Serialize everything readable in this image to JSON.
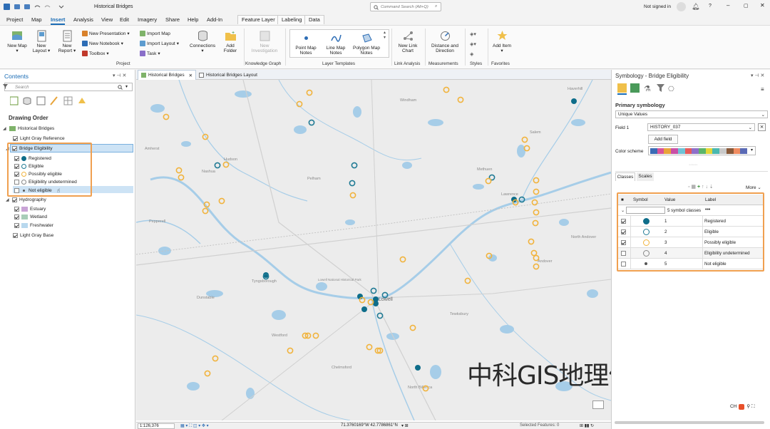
{
  "titlebar": {
    "title": "Historical Bridges",
    "search_placeholder": "Command Search (Alt+Q)",
    "signin": "Not signed in",
    "help": "?"
  },
  "menu": {
    "items": [
      "Project",
      "Map",
      "Insert",
      "Analysis",
      "View",
      "Edit",
      "Imagery",
      "Share",
      "Help",
      "Add-In"
    ],
    "active": "Insert",
    "context": [
      "Feature Layer",
      "Labeling",
      "Data"
    ]
  },
  "ribbon": {
    "new_map": "New Map",
    "new_layout": "New Layout",
    "new_report": "New Report",
    "new_presentation": "New Presentation",
    "new_notebook": "New Notebook",
    "toolbox": "Toolbox",
    "import_map": "Import Map",
    "import_layout": "Import Layout",
    "task": "Task",
    "connections": "Connections",
    "add_folder": "Add Folder",
    "new_investigation": "New Investigation",
    "point_map_notes": "Point Map Notes",
    "line_map_notes": "Line Map Notes",
    "polygon_map_notes": "Polygon Map Notes",
    "new_link_chart": "New Link Chart",
    "distance_direction": "Distance and Direction",
    "add_item": "Add Item",
    "groups": {
      "project": "Project",
      "knowledge_graph": "Knowledge Graph",
      "layer_templates": "Layer Templates",
      "link_analysis": "Link Analysis",
      "measurements": "Measurements",
      "styles": "Styles",
      "favorites": "Favorites"
    }
  },
  "contents": {
    "title": "Contents",
    "search_placeholder": "Search",
    "drawing_order": "Drawing Order",
    "map_name": "Historical Bridges",
    "layers": {
      "light_gray_reference": "Light Gray Reference",
      "bridge_eligibility": "Bridge Eligibility",
      "bridge_classes": [
        {
          "label": "Registered",
          "checked": true
        },
        {
          "label": "Eligible",
          "checked": true
        },
        {
          "label": "Possibly eligible",
          "checked": true
        },
        {
          "label": "Eligibility undetermined",
          "checked": false
        },
        {
          "label": "Not eligible",
          "checked": false
        }
      ],
      "hydrography": "Hydrography",
      "hydro_classes": [
        {
          "label": "Estuary",
          "color": "#c9a3d6"
        },
        {
          "label": "Wetland",
          "color": "#a8cdb8"
        },
        {
          "label": "Freshwater",
          "color": "#b8d8ee"
        }
      ],
      "light_gray_base": "Light Gray Base"
    }
  },
  "map": {
    "tabs": [
      "Historical Bridges",
      "Historical Bridges Layout"
    ],
    "labels": {
      "haverhill": "Haverhill",
      "nashua": "Nashua",
      "hudson": "Hudson",
      "methuen": "Methuen",
      "lawrence": "Lawrence",
      "andover": "Andover",
      "tyngsborough": "Tyngsborough",
      "dunstable": "Dunstable",
      "lowell": "Lowell",
      "chelmsford": "Chelmsford",
      "north_billerica": "North Billerica",
      "amherst": "Amherst",
      "pelham": "Pelham",
      "windham": "Windham",
      "salem": "Salem",
      "north_andover": "North Andover",
      "pepperell": "Pepperell",
      "westford": "Westford",
      "tewksbury": "Tewksbury",
      "lowell_national_historical_park": "Lowell National Historical Park"
    },
    "watermark": "中科GIS地理信息培训"
  },
  "status": {
    "scale": "1:126,376",
    "coords": "71.3760169°W 42.7786861°N",
    "selected": "Selected Features: 0"
  },
  "symbology": {
    "title": "Symbology - Bridge Eligibility",
    "primary_label": "Primary symbology",
    "primary_value": "Unique Values",
    "field1_label": "Field 1",
    "field1_value": "HISTORY_037",
    "add_field": "Add field",
    "color_scheme_label": "Color scheme",
    "color_scheme": [
      "#3b6bb5",
      "#d9539a",
      "#e8a43a",
      "#c94fa6",
      "#6fc3d6",
      "#e85a5a",
      "#8e6fc9",
      "#5bb56a",
      "#e3d63a",
      "#4ab8b0",
      "#c9c9c9",
      "#8a5a3a",
      "#f08c60",
      "#5a6ab5"
    ],
    "tabs": [
      "Classes",
      "Scales"
    ],
    "more": "More",
    "columns": [
      "Symbol",
      "Value",
      "Label"
    ],
    "summary": "5 symbol classes",
    "rows": [
      {
        "checked": true,
        "value": "1",
        "label": "Registered",
        "symbol": "registered"
      },
      {
        "checked": true,
        "value": "2",
        "label": "Eligible",
        "symbol": "eligible"
      },
      {
        "checked": true,
        "value": "3",
        "label": "Possibly eligible",
        "symbol": "possible"
      },
      {
        "checked": false,
        "value": "4",
        "label": "Eligibility undetermined",
        "symbol": "undetermined"
      },
      {
        "checked": false,
        "value": "5",
        "label": "Not eligible",
        "symbol": "not"
      }
    ],
    "lang": "CH"
  },
  "colors": {
    "accent": "#1a6cb5",
    "registered": "#0e6d8a",
    "eligible": "#1f7a94",
    "possibly_eligible": "#f1b33c",
    "highlight_box": "#f0a050",
    "water": "#a6cde8",
    "basemap": "#ececec"
  }
}
